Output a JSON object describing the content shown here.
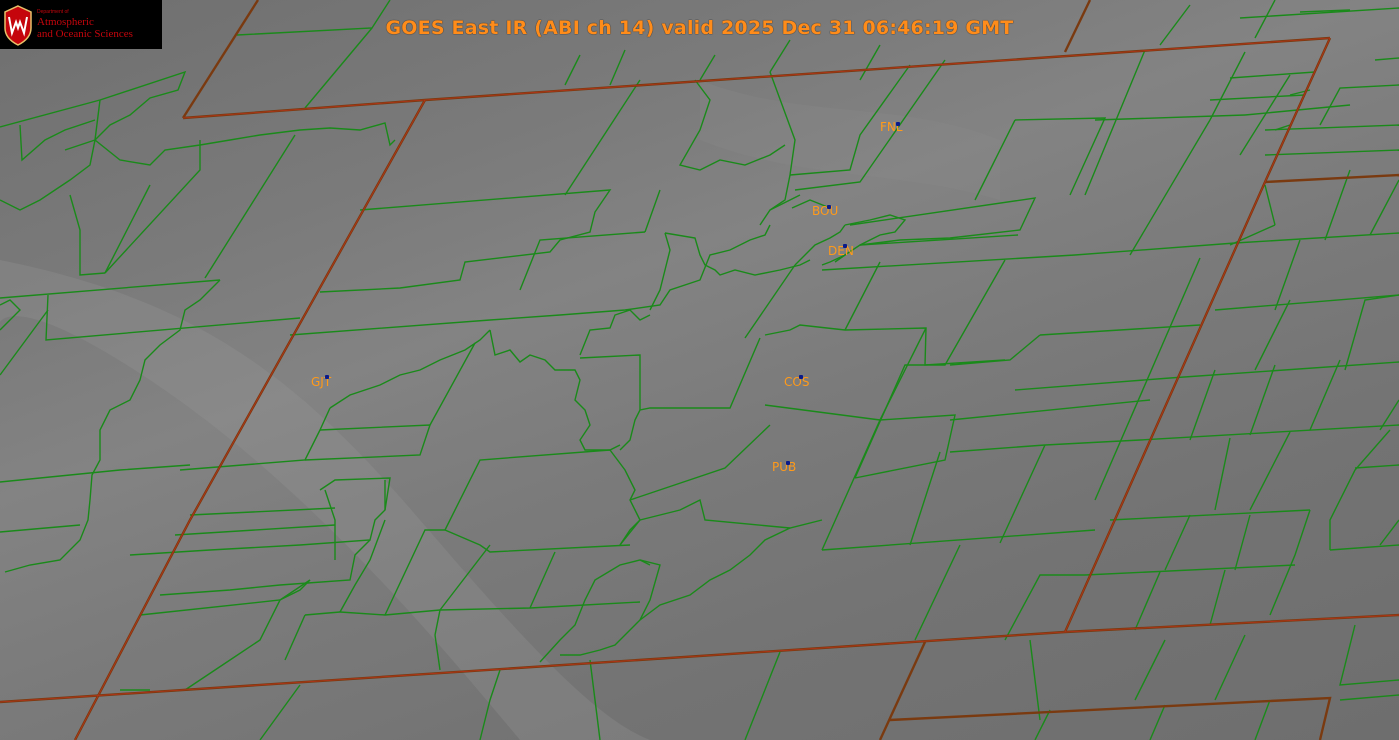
{
  "title": "GOES East IR (ABI ch 14) valid 2025 Dec 31 06:46:19 GMT",
  "logo": {
    "dept": "Department of",
    "line1": "Atmospheric",
    "line2": "and Oceanic Sciences",
    "icon": "uw-crest-icon"
  },
  "stations": [
    {
      "id": "FNL"
    },
    {
      "id": "BOU"
    },
    {
      "id": "DEN"
    },
    {
      "id": "GJT"
    },
    {
      "id": "COS"
    },
    {
      "id": "PUB"
    }
  ],
  "colors": {
    "county_lines": "#1a7a1a",
    "state_lines": "#7a3a10",
    "title": "#ff8c1a",
    "station_label": "#ff9a1a"
  }
}
